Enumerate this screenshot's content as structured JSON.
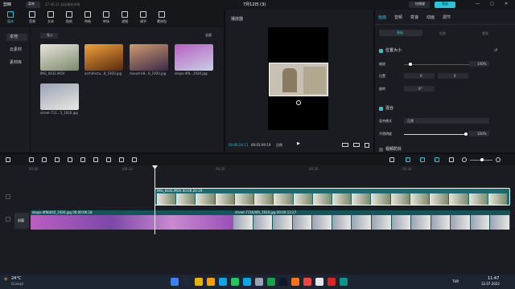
{
  "app": {
    "logo": "剪映",
    "menu": "菜单",
    "autosave": "27:46:11 自动保存本地",
    "title": "7月12日 (3)",
    "shortcut_btn": "快捷键",
    "export_btn": "导出"
  },
  "tools": [
    "媒体",
    "音频",
    "文本",
    "贴纸",
    "特效",
    "转场",
    "滤镜",
    "调节",
    "素材包"
  ],
  "media": {
    "side_items": [
      "本地",
      "云素材",
      "素材库"
    ],
    "import_label": "导入",
    "sort_label": "全部",
    "items": [
      {
        "name": "IMG_0431.MOV",
        "colors": [
          "#e8e4dc",
          "#7c8a6a"
        ]
      },
      {
        "name": "architectu...8_1920.jpg",
        "colors": [
          "#f2a23a",
          "#5a2a10"
        ]
      },
      {
        "name": "mount-k8...6_1920.jpg",
        "colors": [
          "#d19a6e",
          "#3b2a4a"
        ]
      },
      {
        "name": "drops-4f8...1920.jpg",
        "colors": [
          "#b95fc2",
          "#c7d0e6"
        ]
      },
      {
        "name": "street-711...5_1920.jpg",
        "colors": [
          "#9aa4b6",
          "#e9e7e2"
        ]
      }
    ]
  },
  "player": {
    "title": "播放器",
    "time_current": "00:00:24:11",
    "time_total": "00:02:09:19",
    "ratio_label": "比例"
  },
  "inspector": {
    "tabs": [
      "画面",
      "音频",
      "变速",
      "动画",
      "调节"
    ],
    "sub_tabs": [
      "基础",
      "抠像",
      "蒙版"
    ],
    "section1": "位置大小",
    "scale_label": "缩放",
    "scale_value": "100%",
    "position_label": "位置",
    "pos_x": "0",
    "pos_y": "0",
    "rotate_label": "旋转",
    "rotate_value": "0°",
    "section2": "混合",
    "blend_label": "混合模式",
    "blend_value": "正常",
    "opacity_label": "不透明度",
    "opacity_value": "100%",
    "section3": "视频防抖"
  },
  "timeline": {
    "ticks": [
      "00:00",
      "|00:10",
      "00:20",
      "00:30",
      "00:40"
    ],
    "cover_label": "封面",
    "clip_top_label": "IMG_0431.MOV  00:00:20:19",
    "clip_a_label": "drops-4f6b042_1920.jpg  00:00:06:18",
    "clip_b_label": "street-7116409_1920.jpg  00:00:13:27"
  },
  "taskbar": {
    "weather_temp": "24°C",
    "weather_desc": "Güneşli",
    "time": "11:47",
    "date": "12.07.2022",
    "tray": "TUR",
    "apps": [
      "#3b82f6",
      "#1e293b",
      "#eab308",
      "#f59e0b",
      "#0ea5e9",
      "#22c55e",
      "#0ea5e9",
      "#94a3b8",
      "#16a34a",
      "#0f172a",
      "#f97316",
      "#ef4444",
      "#e5e7eb",
      "#dc2626",
      "#0d9488"
    ]
  }
}
